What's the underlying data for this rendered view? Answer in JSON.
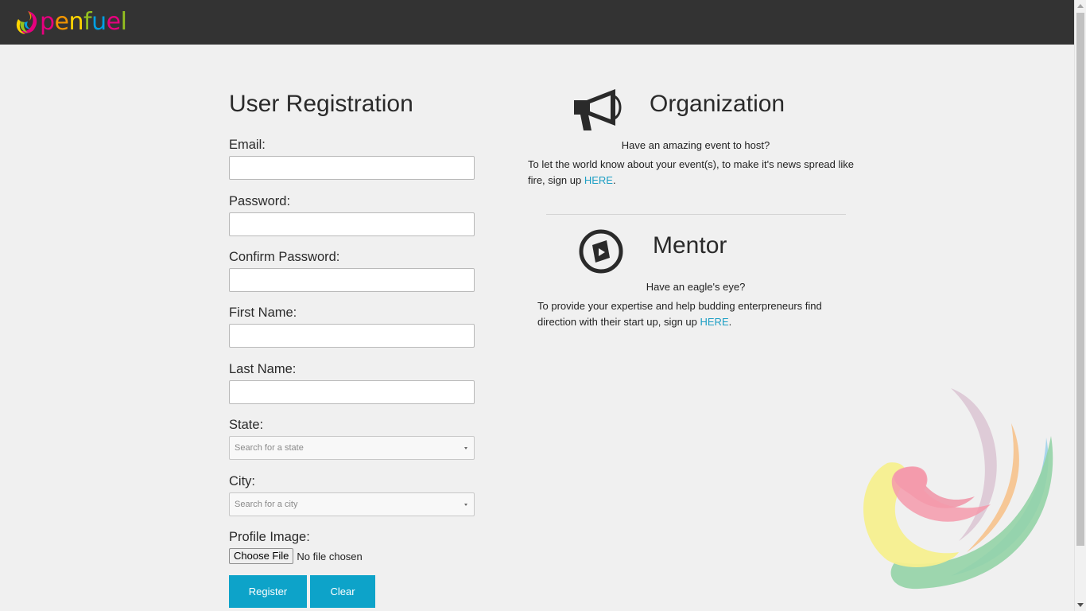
{
  "brand": {
    "name": "openfuel",
    "letters": [
      "p",
      "e",
      "n",
      "f",
      "u",
      "e",
      "l"
    ],
    "letter_colors": [
      "#e6007e",
      "#f29400",
      "#ffd500",
      "#95c11f",
      "#009fe3",
      "#e6007e",
      "#95c11f"
    ]
  },
  "form": {
    "title": "User Registration",
    "fields": {
      "email": {
        "label": "Email:"
      },
      "password": {
        "label": "Password:"
      },
      "confirm_password": {
        "label": "Confirm Password:"
      },
      "first_name": {
        "label": "First Name:"
      },
      "last_name": {
        "label": "Last Name:"
      },
      "state": {
        "label": "State:",
        "placeholder": "Search for a state"
      },
      "city": {
        "label": "City:",
        "placeholder": "Search for a city"
      },
      "profile_image": {
        "label": "Profile Image:",
        "button": "Choose File",
        "status": "No file chosen"
      }
    },
    "register_label": "Register",
    "clear_label": "Clear"
  },
  "organization": {
    "title": "Organization",
    "icon": "megaphone-icon",
    "question": "Have an amazing event to host?",
    "text_line1": "To let the world know about your event(s), to make it's news spread like",
    "text_line2": "fire, sign up ",
    "link": "HERE",
    "end": "."
  },
  "mentor": {
    "title": "Mentor",
    "icon": "mentor-play-icon",
    "question": "Have an eagle's eye?",
    "text_line1": "To provide your expertise and help budding enterpreneurs find",
    "text_line2": "direction with their start up, sign up ",
    "link": "HERE",
    "end": "."
  },
  "colors": {
    "navbar": "#333333",
    "accent": "#0da3c9",
    "link": "#1c9ec4",
    "background": "#f0f0f0"
  }
}
